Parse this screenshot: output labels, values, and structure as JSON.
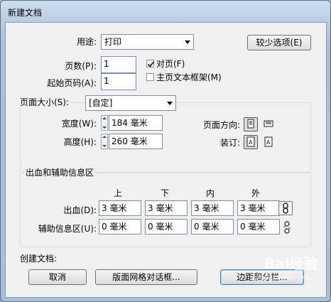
{
  "window": {
    "title": "新建文档"
  },
  "purpose": {
    "label": "用途:",
    "value": "打印"
  },
  "fewer_options_button": "较少选项(E)",
  "pages": {
    "label": "页数(P):",
    "value": "1"
  },
  "start_page": {
    "label": "起始页码(A):",
    "value": "1"
  },
  "facing_pages": {
    "label": "对页(F)",
    "checked": true
  },
  "master_text_frame": {
    "label": "主页文本框架(M)",
    "checked": false
  },
  "page_size": {
    "label": "页面大小(S):",
    "value": "[自定]",
    "width_label": "宽度(W):",
    "width_value": "184 毫米",
    "height_label": "高度(H):",
    "height_value": "260 毫米",
    "orientation_label": "页面方向:",
    "binding_label": "装订:"
  },
  "bleed_slug": {
    "section_title": "出血和辅助信息区",
    "col_top": "上",
    "col_bottom": "下",
    "col_inside": "内",
    "col_outside": "外",
    "bleed_label": "出血(D):",
    "bleed_values": [
      "3 毫米",
      "3 毫米",
      "3 毫米",
      "3 毫米"
    ],
    "slug_label": "辅助信息区(U):",
    "slug_values": [
      "0 毫米",
      "0 毫米",
      "0 毫米",
      "0 毫米"
    ]
  },
  "create_document_label": "创建文档:",
  "buttons": {
    "cancel": "取消",
    "layout_grid": "版面网格对话框...",
    "margins_columns": "边距和分栏..."
  },
  "watermark": {
    "text": "Bai经验",
    "sub": "jingyan.baidu.com"
  }
}
